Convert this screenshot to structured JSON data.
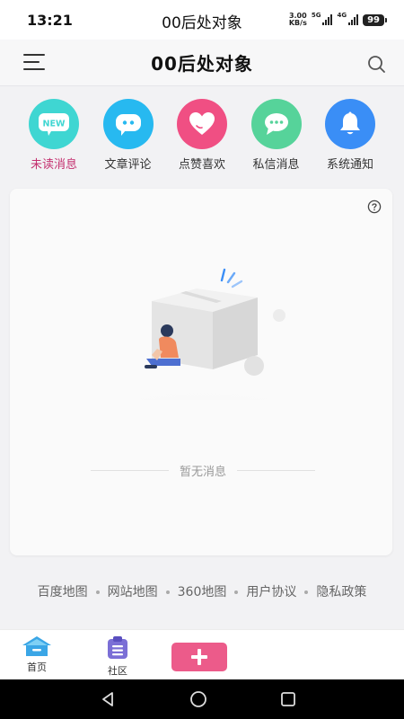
{
  "status_bar": {
    "time": "13:21",
    "title": "00后处对象",
    "speed_value": "3.00",
    "speed_unit": "KB/s",
    "net_5g": "5G",
    "net_4g": "4G",
    "battery": "99"
  },
  "header": {
    "title": "00后处对象",
    "menu_icon": "hamburger-menu-icon",
    "search_icon": "search-icon"
  },
  "categories": [
    {
      "label": "未读消息",
      "icon": "new-badge-icon",
      "color": "#3fd6d2",
      "active": true
    },
    {
      "label": "文章评论",
      "icon": "comment-bubble-icon",
      "color": "#27b9f0",
      "active": false
    },
    {
      "label": "点赞喜欢",
      "icon": "heart-icon",
      "color": "#f04f83",
      "active": false
    },
    {
      "label": "私信消息",
      "icon": "chat-bubble-icon",
      "color": "#56d39a",
      "active": false
    },
    {
      "label": "系统通知",
      "icon": "bell-icon",
      "color": "#3a8ef6",
      "active": false
    }
  ],
  "new_badge_text": "NEW",
  "empty_state": {
    "text": "暂无消息"
  },
  "footer_links": [
    "百度地图",
    "网站地图",
    "360地图",
    "用户协议",
    "隐私政策"
  ],
  "tabs": [
    {
      "label": "首页",
      "icon": "home-icon"
    },
    {
      "label": "社区",
      "icon": "community-icon"
    }
  ],
  "colors": {
    "accent": "#ec5b8a",
    "active_label": "#c4306f"
  }
}
